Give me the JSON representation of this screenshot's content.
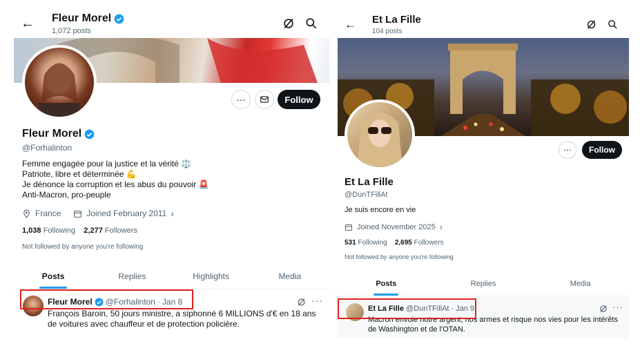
{
  "left": {
    "header": {
      "title": "Fleur Morel",
      "subtitle": "1,072 posts"
    },
    "profile": {
      "name": "Fleur Morel",
      "handle": "@Forhalinton",
      "bio": [
        "Femme engagée pour la justice et la vérité ⚖️",
        "Patriote, libre et déterminée 💪",
        "Je dénonce la corruption et les abus du pouvoir 🚨",
        "Anti-Macron, pro-peuple"
      ],
      "location": "France",
      "joined": "Joined February 2011",
      "following_count": "1,038",
      "following_label": "Following",
      "followers_count": "2,277",
      "followers_label": "Followers",
      "followed_note": "Not followed by anyone you're following"
    },
    "follow_label": "Follow",
    "tabs": [
      "Posts",
      "Replies",
      "Highlights",
      "Media"
    ],
    "post": {
      "name": "Fleur Morel",
      "handle": "@Forhalinton",
      "sep": "·",
      "date": "Jan 8",
      "text": "François Baroin, 50 jours ministre, a siphonné 6 MILLIONS d'€ en 18 ans de voitures avec chauffeur et de protection policière."
    }
  },
  "right": {
    "header": {
      "title": "Et La Fille",
      "subtitle": "104 posts"
    },
    "profile": {
      "name": "Et La Fille",
      "handle": "@DunTFillAt",
      "bio": "Je suis encore en vie",
      "joined": "Joined November 2025",
      "following_count": "531",
      "following_label": "Following",
      "followers_count": "2,695",
      "followers_label": "Followers",
      "followed_note": "Not followed by anyone you're following"
    },
    "follow_label": "Follow",
    "tabs": [
      "Posts",
      "Replies",
      "Media"
    ],
    "post": {
      "name": "Et La Fille",
      "handle": "@DunTFillAt",
      "sep": "·",
      "date": "Jan 9",
      "text": "Macron envoie notre argent, nos armes et risque nos vies pour les intérêts de Washington et de l'OTAN."
    }
  },
  "icons": {
    "back": "arrow-left-icon",
    "grok": "grok-icon",
    "search": "search-icon",
    "more": "more-icon",
    "message": "envelope-icon",
    "verified": "verified-badge-icon",
    "location": "location-pin-icon",
    "calendar": "calendar-icon",
    "chevron": "chevron-right-icon"
  },
  "colors": {
    "verified": "#1d9bf0",
    "follow_bg": "#0f1419",
    "tab_accent": "#1d9bf0",
    "highlight_box": "#e0211f",
    "muted_text": "#536471"
  }
}
